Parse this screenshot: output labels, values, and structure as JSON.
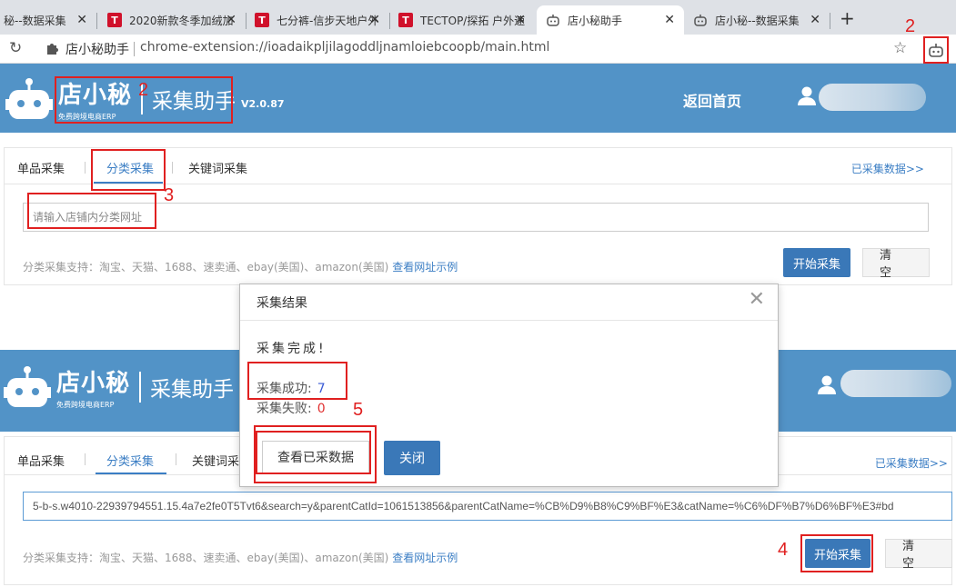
{
  "browser": {
    "tabs": [
      {
        "title": "秘--数据采集",
        "icon": "robot"
      },
      {
        "title": "2020新款冬季加绒加",
        "icon": "T"
      },
      {
        "title": "七分裤-信步天地户外",
        "icon": "T"
      },
      {
        "title": "TECTOP/探拓 户外速",
        "icon": "T"
      },
      {
        "title": "店小秘助手",
        "icon": "robot"
      },
      {
        "title": "店小秘--数据采集",
        "icon": "robot"
      }
    ],
    "address_name": "店小秘助手",
    "address_url": "chrome-extension://ioadaikpljilagoddljnamloiebcoopb/main.html"
  },
  "header": {
    "brand": "店小秘",
    "brand_sub": "免费跨境电商ERP",
    "title": "采集助手",
    "version": "V2.0.87",
    "home_link": "返回首页"
  },
  "panel": {
    "tabs": [
      "单品采集",
      "分类采集",
      "关键词采集"
    ],
    "tab_truncated": "关键词采",
    "collected_link": "已采集数据>>",
    "url_placeholder": "请输入店铺内分类网址",
    "url_value": "5-b-s.w4010-22939794551.15.4a7e2fe0T5Tvt6&search=y&parentCatId=1061513856&parentCatName=%CB%D9%B8%C9%BF%E3&catName=%C6%DF%B7%D6%BF%E3#bd",
    "support_text": "分类采集支持：淘宝、天猫、1688、速卖通、ebay(美国)、amazon(美国) ",
    "support_link": "查看网址示例",
    "start_button": "开始采集",
    "clear_button": "清空"
  },
  "modal": {
    "title": "采集结果",
    "done_text": "采集完成!",
    "success_label": "采集成功:",
    "success_count": "7",
    "fail_label": "采集失败:",
    "fail_count": "0",
    "view_button": "查看已采数据",
    "close_button": "关闭"
  },
  "annotations": {
    "step_ext": "2",
    "step_logo": "2",
    "step_input": "3",
    "step_start": "4",
    "step_view": "5"
  },
  "colors": {
    "header_blue": "#5293c7",
    "button_blue": "#3a78b8",
    "link_blue": "#3b7ec4",
    "annotation_red": "#e02020"
  }
}
